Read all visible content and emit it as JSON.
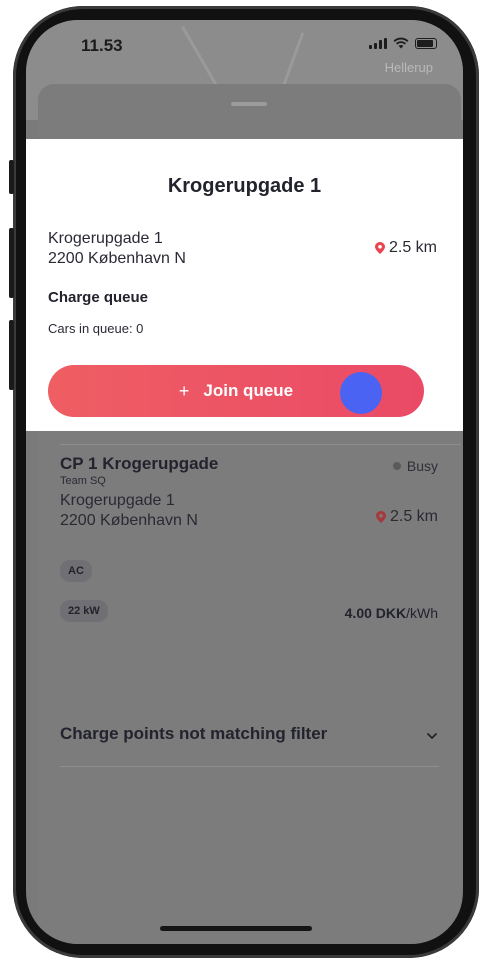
{
  "status_bar": {
    "time": "11.53"
  },
  "map": {
    "place_label": "Hellerup"
  },
  "queue_card": {
    "heading": "Krogerupgade 1",
    "address_line1": "Krogerupgade 1",
    "address_line2": "2200 København N",
    "distance": "2.5 km",
    "section_title": "Charge queue",
    "cars_in_queue": "Cars in queue: 0",
    "join_button": "Join queue",
    "join_icon": "+"
  },
  "charge_point": {
    "title": "CP 1 Krogerupgade",
    "team": "Team SQ",
    "address_line1": "Krogerupgade 1",
    "address_line2": "2200 København N",
    "status": "Busy",
    "distance": "2.5 km",
    "connector": "AC",
    "power": "22 kW",
    "price_value": "4.00 DKK",
    "price_unit": "/kWh"
  },
  "filter_section": {
    "label": "Charge points not matching filter"
  },
  "colors": {
    "accent_start": "#ef5e63",
    "accent_end": "#ea4a66",
    "touch_indicator": "#4a63f2",
    "pin": "#e8454f"
  }
}
